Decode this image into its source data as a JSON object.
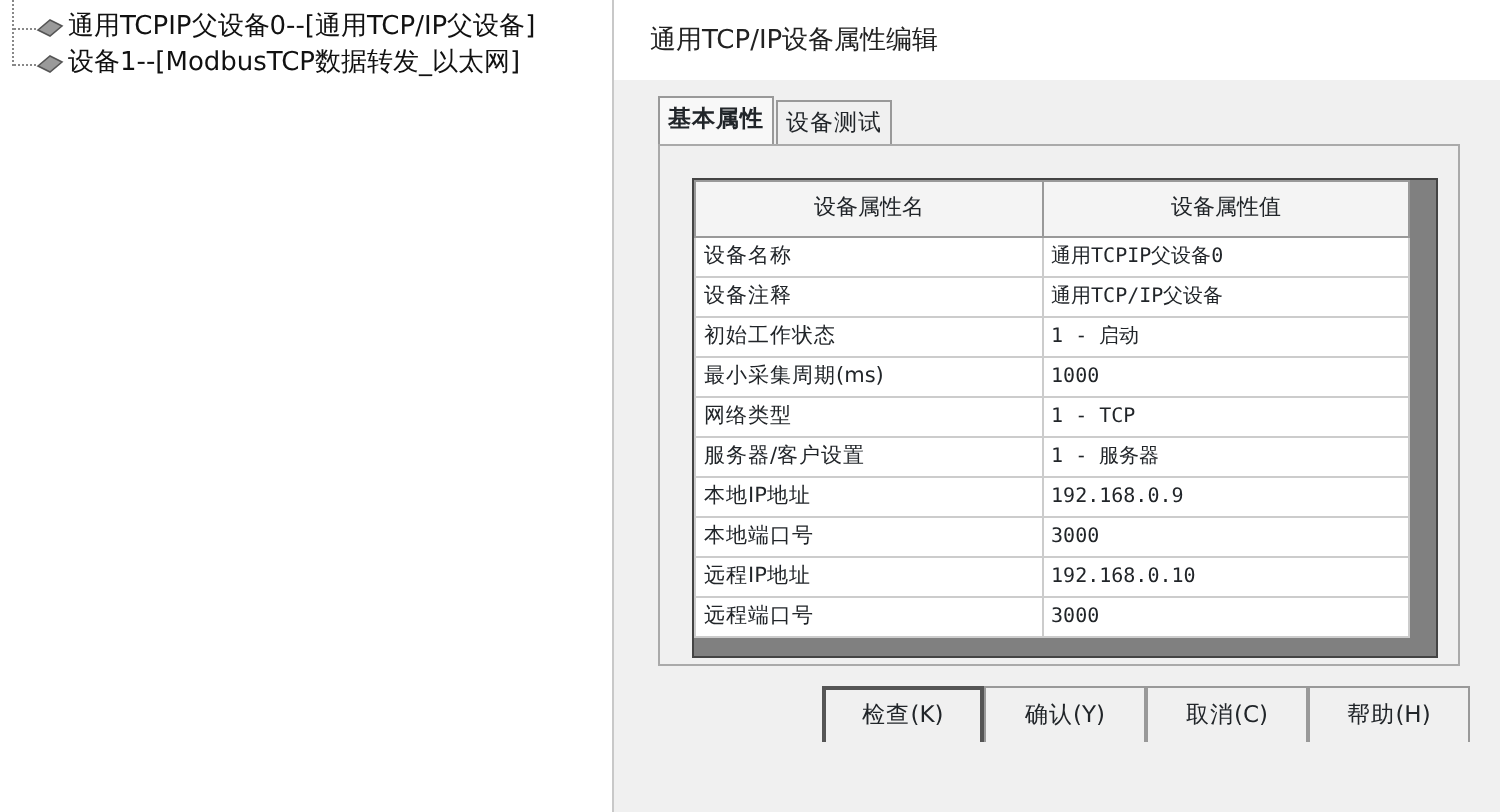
{
  "tree": {
    "items": [
      {
        "label": "通用TCPIP父设备0--[通用TCP/IP父设备]",
        "selected": false
      },
      {
        "label": "设备1--[ModbusTCP数据转发_以太网]",
        "selected": false
      }
    ]
  },
  "dialog": {
    "title": "通用TCP/IP设备属性编辑",
    "tabs": [
      {
        "label": "基本属性",
        "selected": true
      },
      {
        "label": "设备测试",
        "selected": false
      }
    ],
    "table": {
      "columns": [
        "设备属性名",
        "设备属性值"
      ],
      "rows": [
        [
          "设备名称",
          "通用TCPIP父设备0"
        ],
        [
          "设备注释",
          "通用TCP/IP父设备"
        ],
        [
          "初始工作状态",
          "1 - 启动"
        ],
        [
          "最小采集周期(ms)",
          "1000"
        ],
        [
          "网络类型",
          "1 - TCP"
        ],
        [
          "服务器/客户设置",
          "1 - 服务器"
        ],
        [
          "本地IP地址",
          "192.168.0.9"
        ],
        [
          "本地端口号",
          "3000"
        ],
        [
          "远程IP地址",
          "192.168.0.10"
        ],
        [
          "远程端口号",
          "3000"
        ]
      ]
    },
    "buttons": [
      {
        "label": "检查(K)",
        "default": true
      },
      {
        "label": "确认(Y)",
        "default": false
      },
      {
        "label": "取消(C)",
        "default": false
      },
      {
        "label": "帮助(H)",
        "default": false
      }
    ]
  }
}
